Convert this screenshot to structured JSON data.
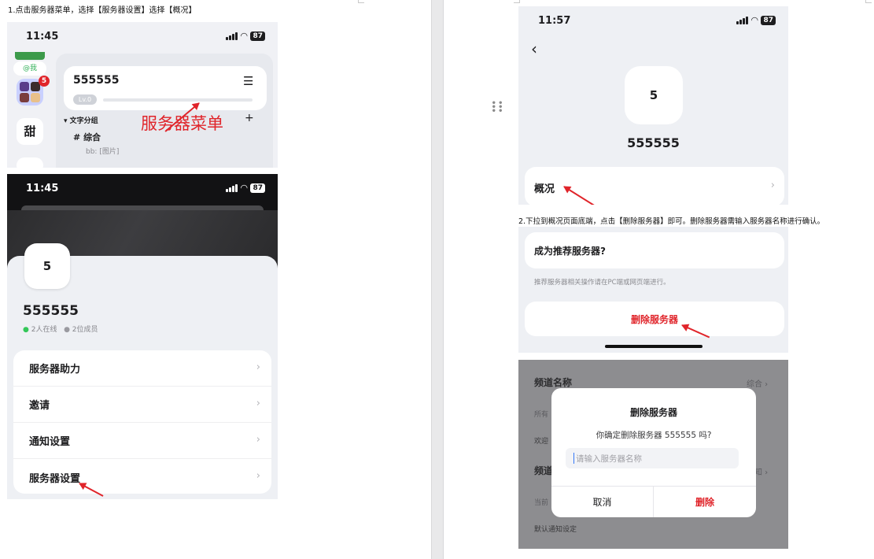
{
  "captions": {
    "step1": "1.点击服务器菜单，选择【服务器设置】选择【概况】",
    "step2": "2.下拉到概况页面底端，点击【删除服务器】即可。删除服务器需输入服务器名称进行确认。"
  },
  "colors": {
    "accent_red": "#e0242a",
    "online_green": "#34c759",
    "panel_bg": "#eef0f4"
  },
  "shot1": {
    "time": "11:45",
    "battery": "87",
    "at_me": "@我",
    "badge": "5",
    "side_char": "甜",
    "server_name": "555555",
    "level": "Lv.0",
    "group_label": "文字分组",
    "channel_name": "综合",
    "channel_preview": "bb: [图片]",
    "annotation": "服务器菜单"
  },
  "shot2": {
    "time": "11:45",
    "battery": "87",
    "avatar_char": "5",
    "server_name": "555555",
    "online": "2人在线",
    "members": "2位成员",
    "menu": [
      "服务器助力",
      "邀请",
      "通知设置",
      "服务器设置"
    ]
  },
  "shot3": {
    "time": "11:57",
    "battery": "87",
    "back": "‹",
    "avatar_char": "5",
    "server_name": "555555",
    "overview": "概况"
  },
  "shot4": {
    "recommend_title": "成为推荐服务器?",
    "recommend_note": "推荐服务器相关操作请在PC端或网页端进行。",
    "delete_label": "删除服务器"
  },
  "shot5": {
    "bg_channel_title": "频道名称",
    "bg_channel_value": "综合",
    "bg_all": "所有",
    "bg_welcome": "欢迎",
    "bg_channel2": "频道",
    "bg_notify": "知",
    "bg_current": "当前",
    "bg_default": "默认通知设定",
    "dialog_title": "删除服务器",
    "dialog_message": "你确定删除服务器 555555 吗?",
    "input_placeholder": "请输入服务器名称",
    "cancel": "取消",
    "confirm": "删除"
  }
}
